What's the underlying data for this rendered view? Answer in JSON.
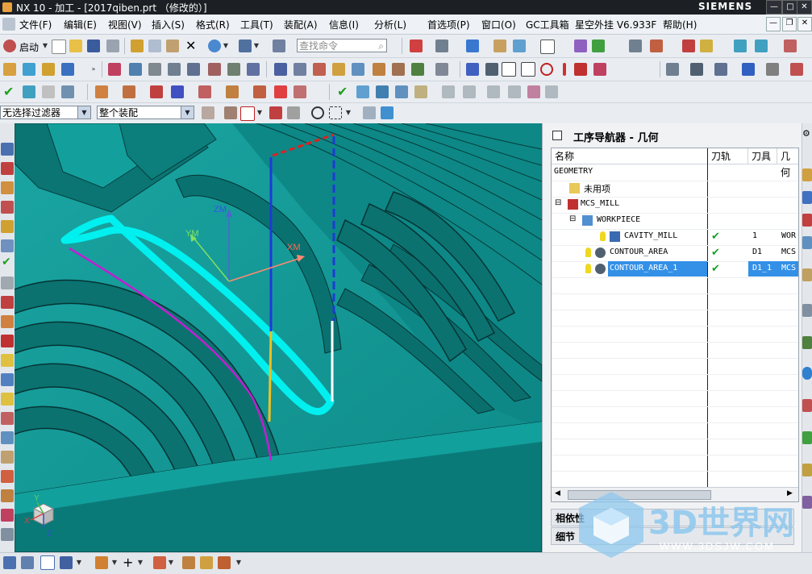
{
  "window": {
    "title": "NX 10 - 加工 - [2017qiben.prt （修改的）]",
    "brand": "SIEMENS"
  },
  "menu": [
    "文件(F)",
    "编辑(E)",
    "视图(V)",
    "插入(S)",
    "格式(R)",
    "工具(T)",
    "装配(A)",
    "信息(I)",
    "分析(L)",
    "首选项(P)",
    "窗口(O)",
    "GC工具箱",
    "星空外挂 V6.933F",
    "帮助(H)"
  ],
  "toolbar": {
    "start_label": "启动",
    "search_placeholder": "查找命令"
  },
  "selection_bar": {
    "filter_value": "无选择过滤器",
    "scope_value": "整个装配"
  },
  "viewport": {
    "axis_zm": "ZM",
    "axis_ym": "YM",
    "axis_xm": "XM",
    "triad_x": "X",
    "triad_y": "Y",
    "triad_z": "Z",
    "colors": {
      "background": "#0b8585",
      "tool_path_highlight": "#00f0f0",
      "toolpath_purple": "#c020d0"
    }
  },
  "navigator": {
    "title": "工序导航器 - 几何",
    "columns": [
      "名称",
      "刀轨",
      "刀具",
      "几何"
    ],
    "rows": [
      {
        "name": "GEOMETRY",
        "toolpath": "",
        "tool": "",
        "geom": "",
        "selected": false
      },
      {
        "name": "未用项",
        "toolpath": "",
        "tool": "",
        "geom": "",
        "selected": false
      },
      {
        "name": "MCS_MILL",
        "toolpath": "",
        "tool": "",
        "geom": "",
        "selected": false
      },
      {
        "name": "WORKPIECE",
        "toolpath": "",
        "tool": "",
        "geom": "",
        "selected": false
      },
      {
        "name": "CAVITY_MILL",
        "toolpath": "✔",
        "tool": "1",
        "geom": "WOR",
        "selected": false
      },
      {
        "name": "CONTOUR_AREA",
        "toolpath": "✔",
        "tool": "D1",
        "geom": "MCS",
        "selected": false
      },
      {
        "name": "CONTOUR_AREA_1",
        "toolpath": "✔",
        "tool": "D1_1",
        "geom": "MCS",
        "selected": true
      }
    ],
    "panel_dependencies": "相依性",
    "panel_details": "细节"
  },
  "watermark": {
    "text": "3D世界网",
    "url": "WWW.3DSJW.COM"
  }
}
